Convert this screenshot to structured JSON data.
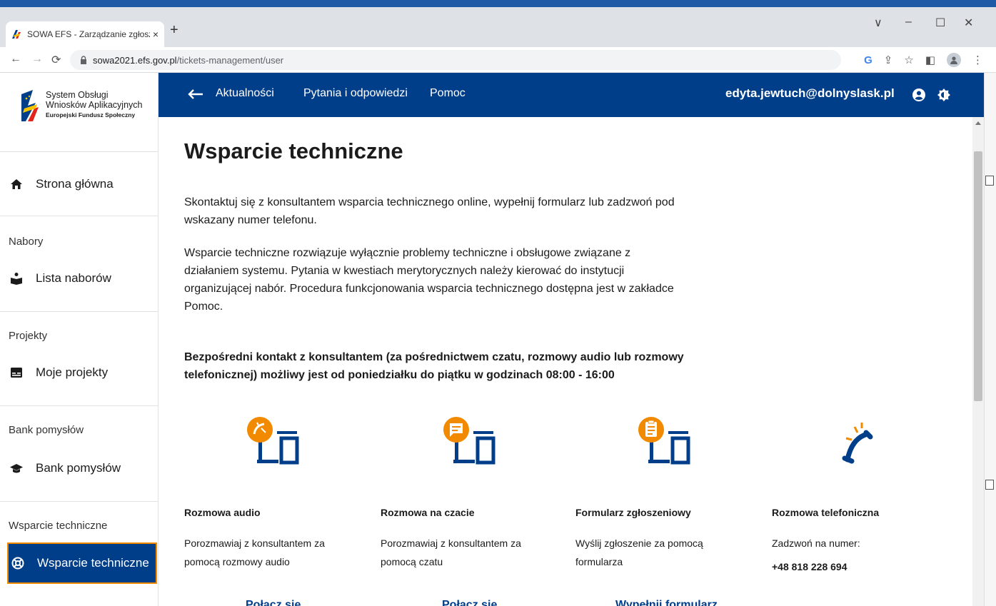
{
  "browser": {
    "tab_title": "SOWA EFS - Zarządzanie zgłoszeniami",
    "tab_close": "×",
    "new_tab": "+",
    "url_host": "sowa2021.efs.gov.pl",
    "url_path": "/tickets-management/user",
    "window_controls": [
      "∨",
      "–",
      "☐",
      "✕"
    ]
  },
  "logo": {
    "line1": "System Obsługi",
    "line2": "Wniosków Aplikacyjnych",
    "line3": "Europejski Fundusz Społeczny"
  },
  "sidebar": {
    "home": "Strona główna",
    "sections": [
      {
        "label": "Nabory",
        "item": "Lista naborów"
      },
      {
        "label": "Projekty",
        "item": "Moje projekty"
      },
      {
        "label": "Bank pomysłów",
        "item": "Bank pomysłów"
      },
      {
        "label": "Wsparcie techniczne",
        "item": "Wsparcie techniczne"
      }
    ]
  },
  "header": {
    "links": [
      "Aktualności",
      "Pytania i odpowiedzi",
      "Pomoc"
    ],
    "user_email": "edyta.jewtuch@dolnyslask.pl"
  },
  "main": {
    "title": "Wsparcie techniczne",
    "intro1": "Skontaktuj się z konsultantem wsparcia technicznego online, wypełnij formularz lub zadzwoń pod wskazany numer telefonu.",
    "intro2": "Wsparcie techniczne rozwiązuje wyłącznie problemy techniczne i obsługowe związane z działaniem systemu. Pytania w kwestiach merytorycznych należy kierować do instytucji organizującej nabór. Procedura funkcjonowania wsparcia technicznego dostępna jest w zakładce Pomoc.",
    "hours": "Bezpośredni kontakt z konsultantem (za pośrednictwem czatu, rozmowy audio lub rozmowy telefonicznej) możliwy jest od poniedziałku do piątku w godzinach 08:00 - 16:00",
    "channels": [
      {
        "title": "Rozmowa audio",
        "desc": "Porozmawiaj z konsultantem za pomocą rozmowy audio",
        "action": "Połącz się"
      },
      {
        "title": "Rozmowa na czacie",
        "desc": "Porozmawiaj z konsultantem za pomocą czatu",
        "action": "Połącz się"
      },
      {
        "title": "Formularz zgłoszeniowy",
        "desc": "Wyślij zgłoszenie za pomocą formularza",
        "action": "Wypełnij formularz"
      },
      {
        "title": "Rozmowa telefoniczna",
        "desc": "Zadzwoń na numer:",
        "phone": "+48 818 228 694"
      }
    ]
  },
  "colors": {
    "primary": "#003e8a",
    "accent": "#f28a00",
    "browser_strip": "#1e5aa6"
  }
}
